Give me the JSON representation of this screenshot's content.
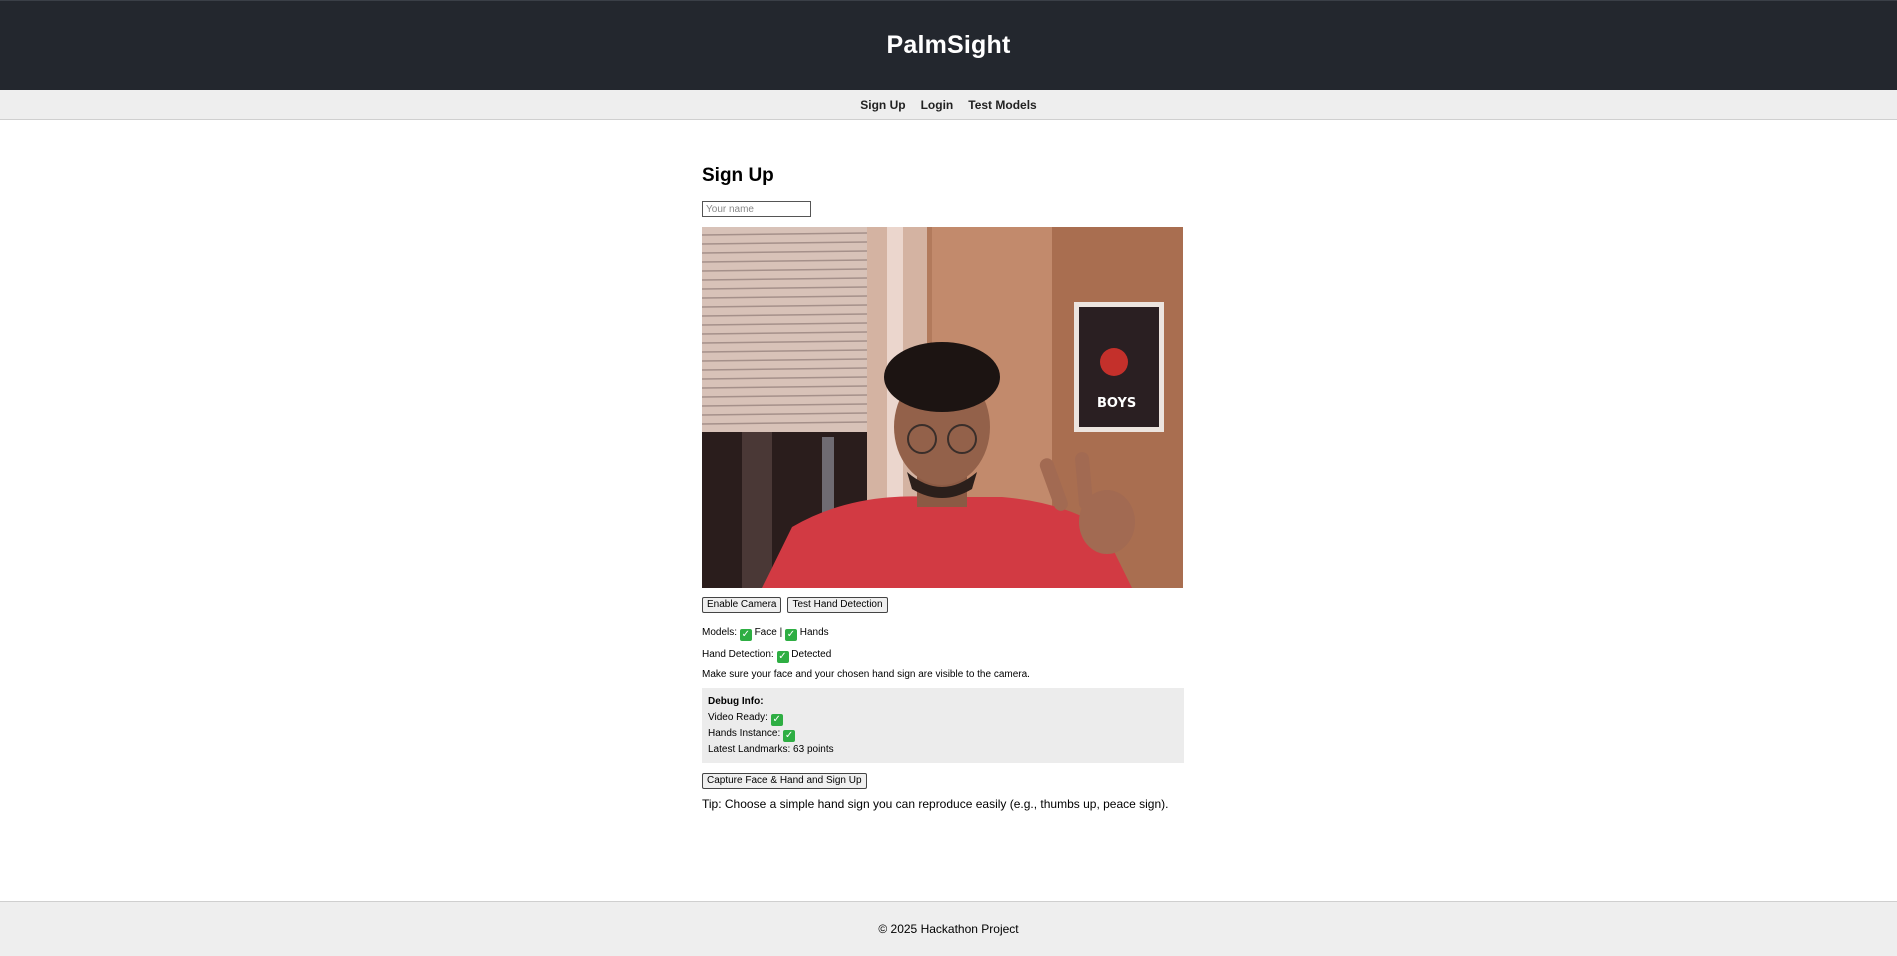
{
  "header": {
    "title": "PalmSight"
  },
  "nav": {
    "items": [
      "Sign Up",
      "Login",
      "Test Models"
    ]
  },
  "signup": {
    "heading": "Sign Up",
    "name_placeholder": "Your name",
    "name_value": "",
    "enable_camera_label": "Enable Camera",
    "test_hand_label": "Test Hand Detection",
    "models_label": "Models:",
    "models_face": "Face |",
    "models_hands": "Hands",
    "hand_detection_label": "Hand Detection:",
    "hand_detection_value": "Detected",
    "instructions": "Make sure your face and your chosen hand sign are visible to the camera.",
    "debug": {
      "title": "Debug Info:",
      "video_ready_label": "Video Ready:",
      "hands_instance_label": "Hands Instance:",
      "latest_landmarks": "Latest Landmarks: 63 points"
    },
    "capture_label": "Capture Face & Hand and Sign Up",
    "tip": "Tip: Choose a simple hand sign you can reproduce easily (e.g., thumbs up, peace sign)."
  },
  "check_glyph": "✓",
  "footer": {
    "text": "© 2025 Hackathon Project"
  },
  "colors": {
    "header_bg": "#23272e",
    "check_green": "#2eae43",
    "nav_bg": "#eeeeee"
  }
}
